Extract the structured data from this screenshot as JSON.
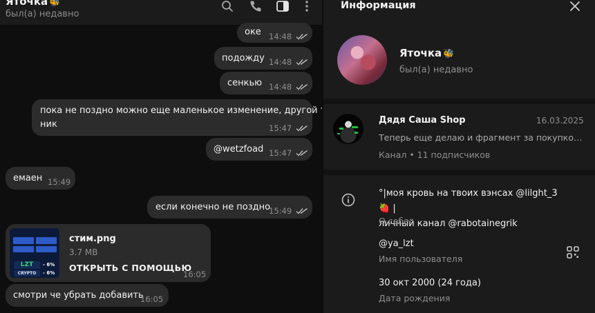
{
  "chat": {
    "title": "Яточка",
    "title_emoji": "🐝",
    "status": "был(а) недавно",
    "header_icons": [
      "search-icon",
      "phone-icon",
      "sidebar-toggle-icon",
      "more-vertical-icon"
    ],
    "messages": [
      {
        "direction": "out",
        "text": "оке",
        "time": "14:48",
        "read": true
      },
      {
        "direction": "out",
        "text": "подожду",
        "time": "14:48",
        "read": true
      },
      {
        "direction": "out",
        "text": "сенкью",
        "time": "14:48",
        "read": true
      },
      {
        "direction": "out",
        "text_line1": "пока не поздно можно еще маленькое изменение, другой тг",
        "text_line2": "ник",
        "time": "15:47",
        "read": true
      },
      {
        "direction": "out",
        "text": "@wetzfoad",
        "time": "15:47",
        "read": true
      },
      {
        "direction": "in",
        "text": "емаен",
        "time": "15:49"
      },
      {
        "direction": "out",
        "text": "если конечно не поздно",
        "time": "15:49",
        "read": true
      },
      {
        "direction": "in",
        "type": "file",
        "file_name": "стим.png",
        "file_size": "3.7 MB",
        "action": "ОТКРЫТЬ С ПОМОЩЬЮ",
        "time": "16:05",
        "thumb": {
          "logo": "LZT",
          "logo2": "CRYPTO",
          "pct1": "- 6%",
          "pct2": "- 6%"
        }
      },
      {
        "direction": "in",
        "text": "смотри че убрать добавить",
        "time": "16:05"
      }
    ]
  },
  "info": {
    "header_title": "Информация",
    "name": "Яточка",
    "name_emoji": "🐝",
    "status": "был(а) недавно",
    "channel": {
      "name": "Дядя Саша Shop",
      "date": "16.03.2025",
      "last_message": "Теперь еще делаю и фрагмент за покупкой в...",
      "subscribers": "Канал • 11 подписчиков"
    },
    "bio_line1": "°|моя кровь на твоих вэнсах @lilght_3 🍓 |",
    "bio_line2": "личный канал @rabotainegrik",
    "bio_label": "О себе",
    "username": "@ya_lzt",
    "username_label": "Имя пользователя",
    "birthday": "30 окт 2000 (24 года)",
    "birthday_label": "Дата рождения"
  },
  "colors": {
    "chat_bg": "#0e0e0e",
    "panel_bg": "#1b1b1b",
    "bubble": "#2b2b2b",
    "muted_text": "#8e8e8e",
    "emoji_yellow": "#f0d23c"
  }
}
